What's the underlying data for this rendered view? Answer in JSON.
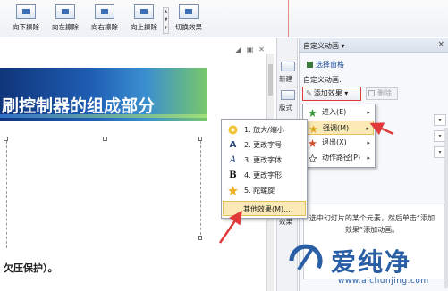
{
  "ribbon": {
    "buttons": [
      {
        "label": "向下擦除",
        "icon": "wipe-down-icon"
      },
      {
        "label": "向左擦除",
        "icon": "wipe-left-icon"
      },
      {
        "label": "向右擦除",
        "icon": "wipe-right-icon"
      },
      {
        "label": "向上擦除",
        "icon": "wipe-up-icon"
      },
      {
        "label": "切换效果",
        "icon": "transition-effect-icon"
      }
    ]
  },
  "slide": {
    "title": "刷控制器的组成部分",
    "body_text": "欠压保护）。"
  },
  "strip": {
    "items": [
      {
        "label": "新建"
      },
      {
        "label": "版式"
      },
      {
        "label": "效果"
      }
    ]
  },
  "pane": {
    "title": "自定义动画",
    "close_glyph": "×",
    "select_pane_link": "选择窗格",
    "custom_animation_label": "自定义动画:",
    "add_effect_button": "添加效果",
    "delete_button": "删除",
    "info_text": "选中幻灯片的某个元素，然后单击“添加效果”添加动画。"
  },
  "submenu": {
    "items": [
      {
        "label": "进入(E)",
        "icon": "enter-effect-icon",
        "color": "#3a9a3a"
      },
      {
        "label": "强调(M)",
        "icon": "emphasis-effect-icon",
        "color": "#e0a21a",
        "highlighted": true
      },
      {
        "label": "退出(X)",
        "icon": "exit-effect-icon",
        "color": "#d24a2a"
      },
      {
        "label": "动作路径(P)",
        "icon": "motion-path-icon",
        "color": "#555555"
      }
    ]
  },
  "emphasis_menu": {
    "items": [
      {
        "label": "1. 放大/缩小",
        "icon": "grow-shrink-icon"
      },
      {
        "label": "2. 更改字号",
        "icon": "change-font-size-icon"
      },
      {
        "label": "3. 更改字体",
        "icon": "change-font-icon"
      },
      {
        "label": "4. 更改字形",
        "icon": "change-font-style-icon"
      },
      {
        "label": "5. 陀螺旋",
        "icon": "spin-icon"
      },
      {
        "label": "其他效果(M)...",
        "icon": "",
        "highlighted": true
      }
    ]
  },
  "watermark": {
    "brand": "爱纯净",
    "url": "www.aichunjing.com"
  },
  "colors": {
    "accent_red": "#e23a3a",
    "highlight": "#fbe9b6",
    "brand_blue": "#2b5fa5"
  }
}
